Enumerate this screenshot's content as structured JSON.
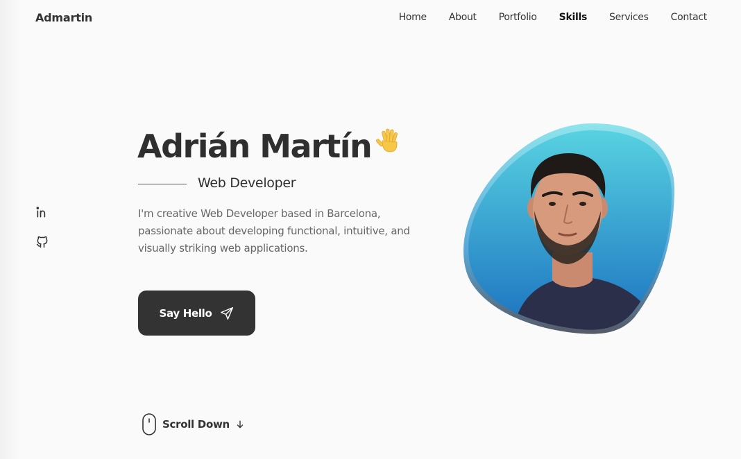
{
  "header": {
    "logo": "Admartin",
    "nav": [
      "Home",
      "About",
      "Portfolio",
      "Skills",
      "Services",
      "Contact"
    ],
    "active_nav": "Skills"
  },
  "socials": [
    {
      "icon": "linkedin-icon"
    },
    {
      "icon": "github-icon"
    }
  ],
  "hero": {
    "name": "Adrián Martín",
    "subtitle": "Web Developer",
    "description": "I'm creative Web Developer based in Barcelona, passionate about developing functional, intuitive, and visually striking web applications.",
    "cta_label": "Say Hello",
    "scroll_label": "Scroll Down"
  },
  "colors": {
    "primary": "#333333",
    "background": "#fafafa",
    "blob_top": "#5ad6e2",
    "blob_bottom": "#1a6fbf",
    "text_muted": "#666666"
  },
  "icons": {
    "wave": "waving-hand-icon",
    "send": "send-icon",
    "mouse": "mouse-icon",
    "arrow_down": "arrow-down-icon"
  }
}
